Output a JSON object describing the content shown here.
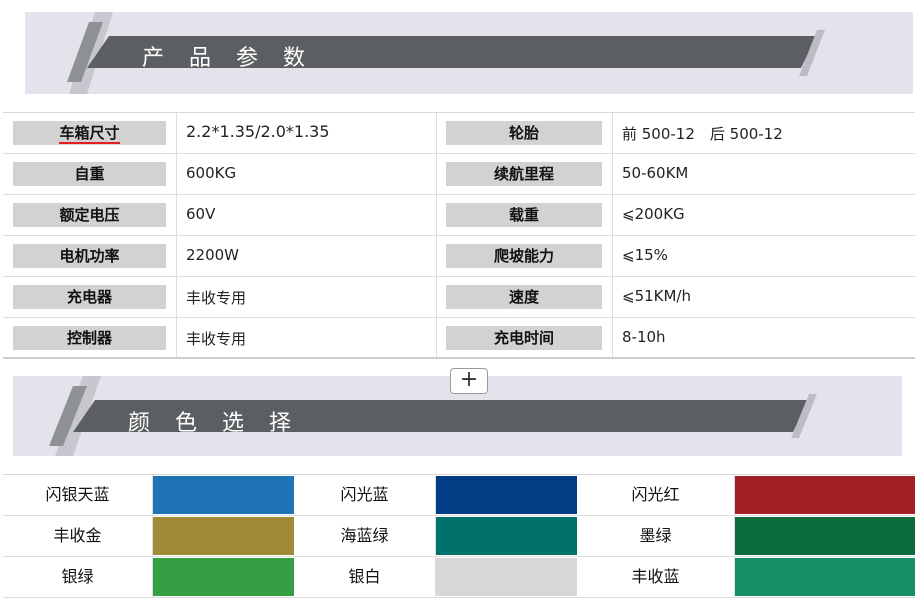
{
  "header": {
    "title": "产品参数"
  },
  "params": [
    {
      "label_left": "车箱尺寸",
      "value_left": "2.2*1.35/2.0*1.35",
      "label_right": "轮胎",
      "value_right": "前 500-12　后 500-12"
    },
    {
      "label_left": "自重",
      "value_left": "600KG",
      "label_right": "续航里程",
      "value_right": "50-60KM"
    },
    {
      "label_left": "额定电压",
      "value_left": "60V",
      "label_right": "载重",
      "value_right": "⩽200KG"
    },
    {
      "label_left": "电机功率",
      "value_left": "2200W",
      "label_right": "爬坡能力",
      "value_right": "⩽15%"
    },
    {
      "label_left": "充电器",
      "value_left": "丰收专用",
      "label_right": "速度",
      "value_right": "⩽51KM/h"
    },
    {
      "label_left": "控制器",
      "value_left": "丰收专用",
      "label_right": "充电时间",
      "value_right": "8-10h"
    }
  ],
  "expand_button": {
    "label": "+"
  },
  "colors_section": {
    "title": "颜色选择"
  },
  "colors": [
    [
      {
        "name": "闪银天蓝",
        "color": "#1f74b6"
      },
      {
        "name": "闪光蓝",
        "color": "#003d85"
      },
      {
        "name": "闪光红",
        "color": "#a31f25"
      }
    ],
    [
      {
        "name": "丰收金",
        "color": "#a08a37"
      },
      {
        "name": "海蓝绿",
        "color": "#00726a"
      },
      {
        "name": "墨绿",
        "color": "#0b6b3a"
      }
    ],
    [
      {
        "name": "银绿",
        "color": "#34a043"
      },
      {
        "name": "银白",
        "color": "#d7d7d7"
      },
      {
        "name": "丰收蓝",
        "color": "#168f64"
      }
    ]
  ],
  "theme": {
    "banner_bg": "#e4e3ec",
    "banner_stripe": "#5b5f61",
    "label_bg": "#d2d2d2"
  }
}
